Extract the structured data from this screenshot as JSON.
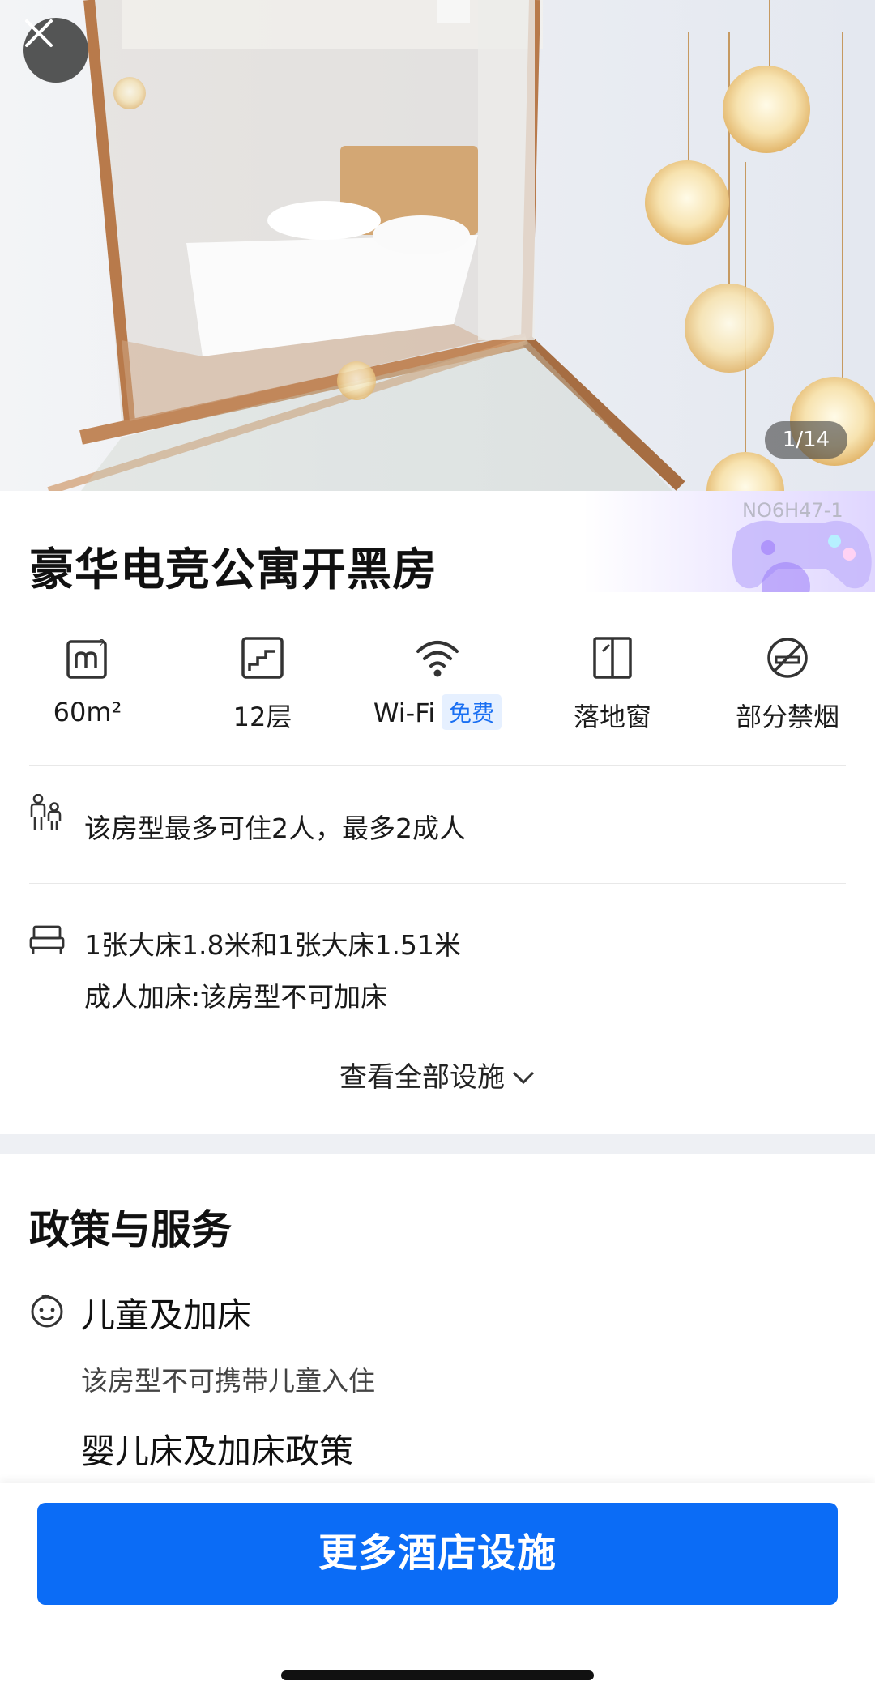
{
  "photo": {
    "counter": "1/14",
    "description_icon": "room-photo"
  },
  "room": {
    "code": "NO6H47-1",
    "title": "豪华电竞公寓开黑房"
  },
  "amenities": [
    {
      "icon": "area-icon",
      "label": "60m²"
    },
    {
      "icon": "floor-icon",
      "label": "12层"
    },
    {
      "icon": "wifi-icon",
      "label": "Wi-Fi",
      "badge": "免费"
    },
    {
      "icon": "window-icon",
      "label": "落地窗"
    },
    {
      "icon": "no-smoking-icon",
      "label": "部分禁烟"
    }
  ],
  "occupancy": {
    "icon": "people-icon",
    "text": "该房型最多可住2人，最多2成人"
  },
  "beds": {
    "icon": "bed-icon",
    "line1": "1张大床1.8米和1张大床1.51米",
    "line2": "成人加床:该房型不可加床"
  },
  "see_all": {
    "label": "查看全部设施",
    "icon": "chevron-down-icon"
  },
  "policy": {
    "heading": "政策与服务",
    "children_icon": "child-face-icon",
    "children_title": "儿童及加床",
    "children_desc": "该房型不可携带儿童入住",
    "crib_title": "婴儿床及加床政策"
  },
  "cta": {
    "label": "更多酒店设施",
    "color": "#0b6cf6"
  }
}
